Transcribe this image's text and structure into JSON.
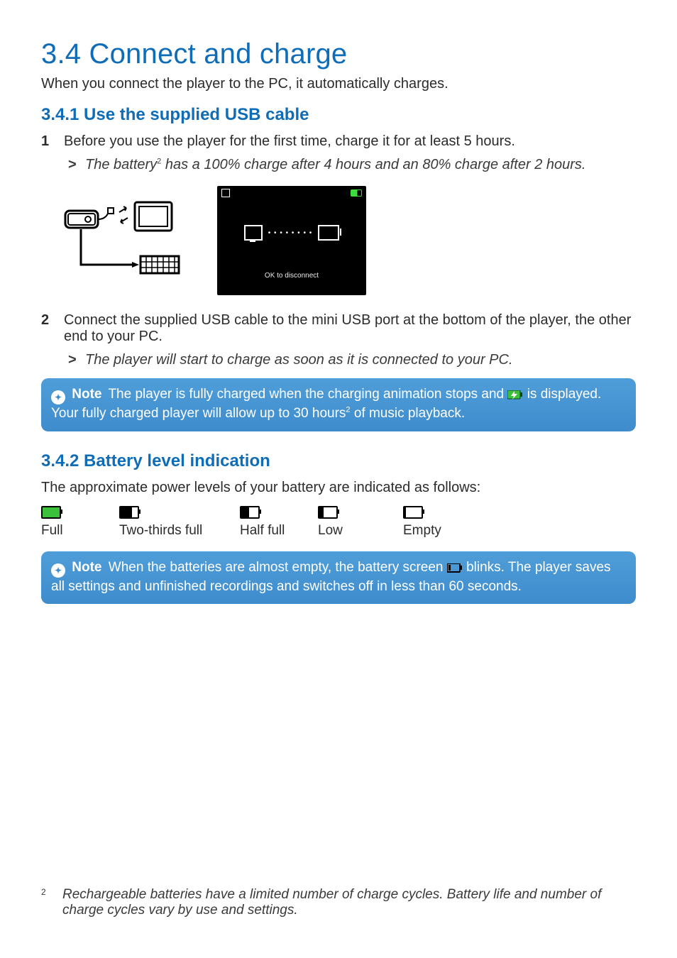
{
  "heading": "3.4  Connect and charge",
  "intro": "When you connect the player to the PC, it automatically charges.",
  "section1": {
    "title": "3.4.1 Use the supplied USB cable",
    "step1_num": "1",
    "step1_text": "Before you use the player for the first time, charge it for at least 5 hours.",
    "step1_sub_gt": ">",
    "step1_sub_a": "The battery",
    "step1_sub_sup": "2",
    "step1_sub_b": " has a 100% charge after 4 hours and an 80% charge after 2 hours.",
    "ok_text": "OK to disconnect",
    "step2_num": "2",
    "step2_text": "Connect the supplied USB cable to the mini USB port at the bottom of the player, the other end to your PC.",
    "step2_sub_gt": ">",
    "step2_sub": "The player will start to charge as soon as it is connected to your PC."
  },
  "note1": {
    "label": "Note",
    "part_a": "The player is fully charged when the charging animation stops and ",
    "part_b": " is displayed. Your fully charged player will allow up to 30 hours",
    "sup": "2",
    "part_c": " of music playback."
  },
  "section2": {
    "title": "3.4.2 Battery level indication",
    "intro": "The approximate power levels of your battery are indicated as follows:",
    "levels": {
      "full": "Full",
      "two_thirds": "Two-thirds full",
      "half": "Half full",
      "low": "Low",
      "empty": "Empty"
    }
  },
  "note2": {
    "label": "Note",
    "part_a": "When the batteries are almost empty, the battery screen ",
    "part_b": " blinks. The player saves all settings and unfinished recordings and switches off in less than 60 seconds."
  },
  "footnote": {
    "num": "2",
    "text": "Rechargeable batteries have a limited number of charge cycles. Battery life and number of charge cycles vary by use and settings."
  }
}
